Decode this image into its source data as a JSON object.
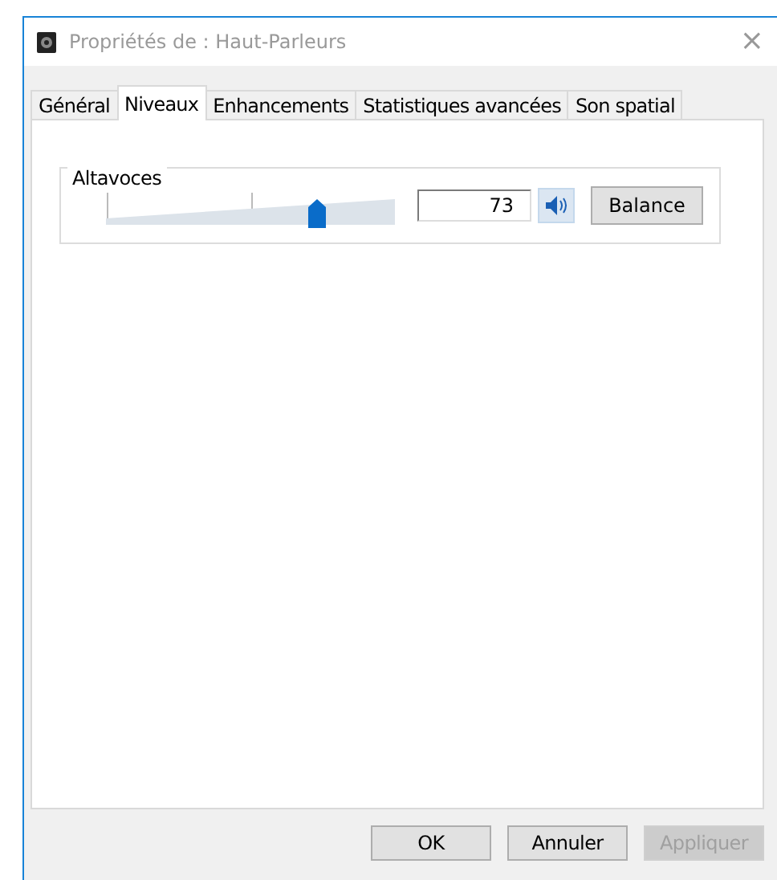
{
  "window": {
    "title": "Propriétés de : Haut-Parleurs",
    "close": "×"
  },
  "tabs": [
    {
      "label": "Général",
      "selected": false
    },
    {
      "label": "Niveaux",
      "selected": true
    },
    {
      "label": "Enhancements",
      "selected": false
    },
    {
      "label": "Statistiques avancées",
      "selected": false
    },
    {
      "label": "Son spatial",
      "selected": false
    }
  ],
  "channels": [
    {
      "name": "Altavoces",
      "level": 0.73,
      "value": "73",
      "muted": false,
      "balance_button": "Balance"
    }
  ],
  "buttons": [
    {
      "label": "OK",
      "disabled": false
    },
    {
      "label": "Annuler",
      "disabled": false
    },
    {
      "label": "Appliquer",
      "disabled": true
    }
  ]
}
